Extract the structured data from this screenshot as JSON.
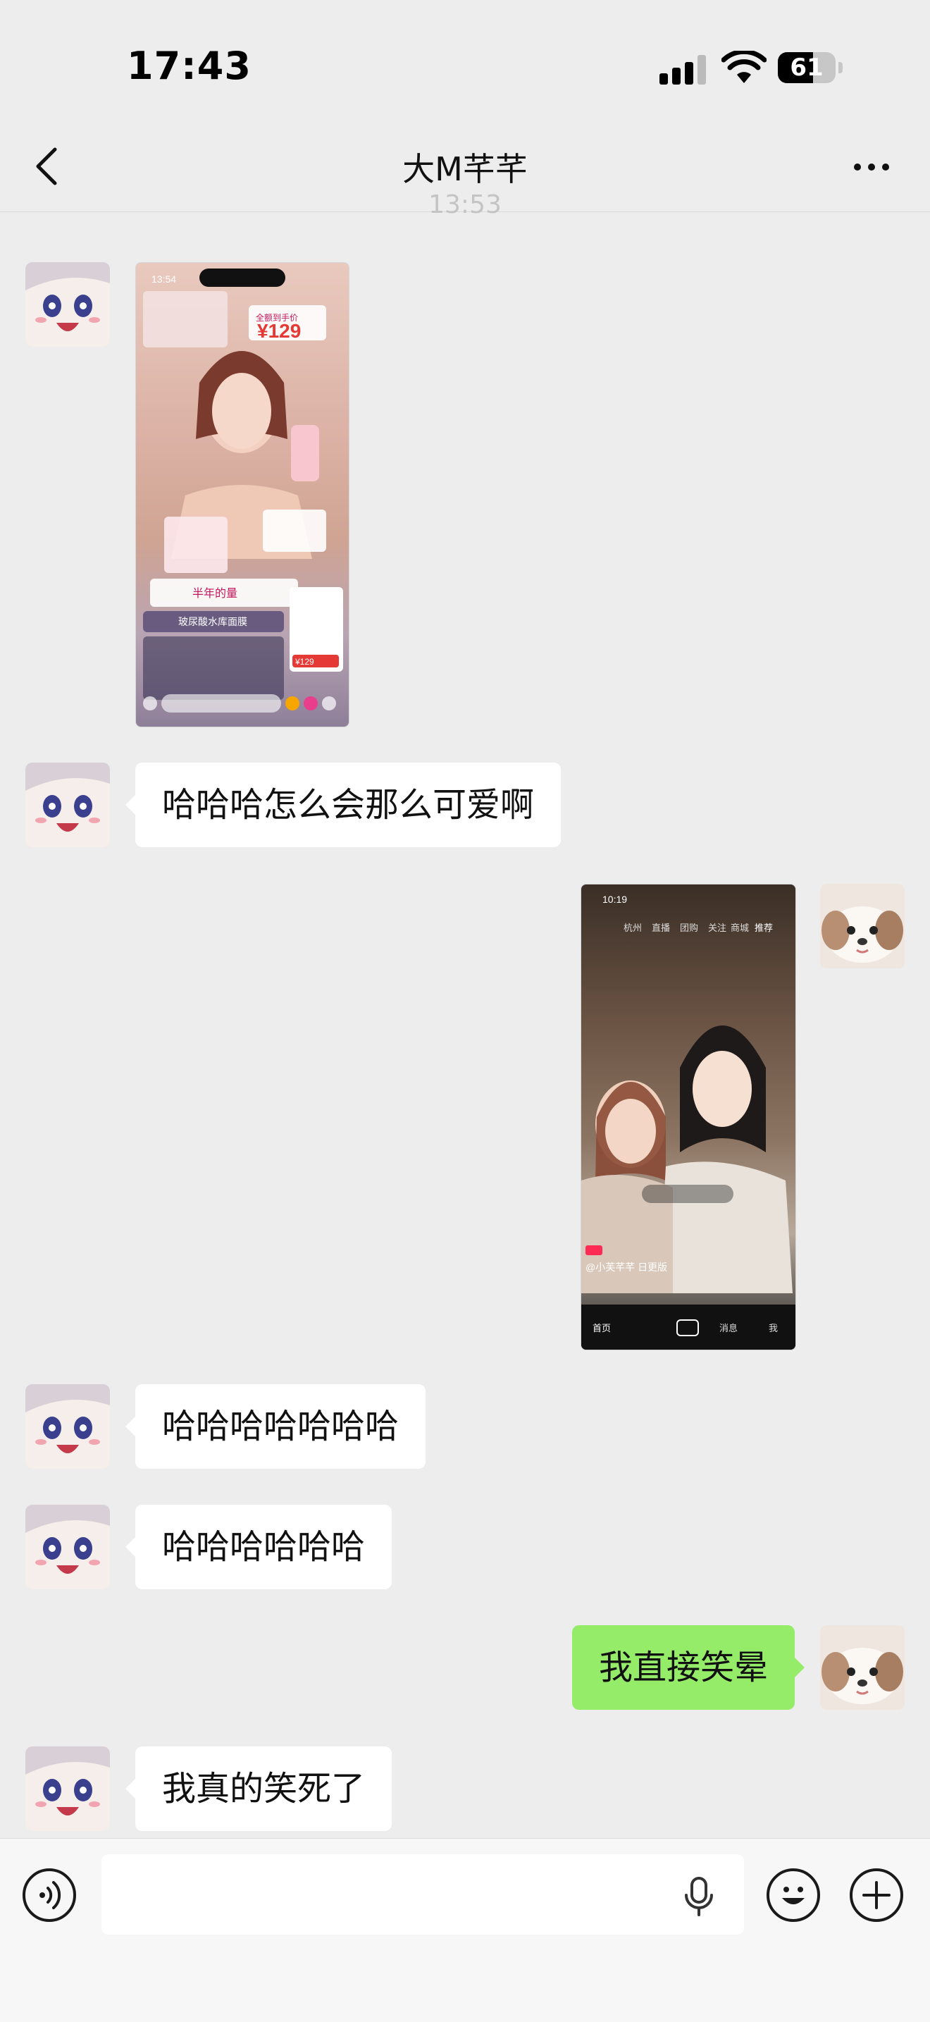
{
  "status_bar": {
    "time": "17:43",
    "battery": "61",
    "battery_level": 0.61
  },
  "nav": {
    "title": "大M芊芊",
    "back_icon": "chevron-left-icon",
    "more_icon": "ellipsis-icon"
  },
  "timestamp": "13:53",
  "messages": [
    {
      "side": "left",
      "type": "image",
      "thumbnail_texts": [
        "13:54",
        "全额到手价",
        "¥129",
        "半年的量",
        "玻尿酸水库面膜",
        "¥129"
      ]
    },
    {
      "side": "left",
      "type": "text",
      "text": "哈哈哈怎么会那么可爱啊"
    },
    {
      "side": "right",
      "type": "image",
      "thumbnail_texts": [
        "10:19",
        "杭州",
        "直播",
        "团购",
        "关注",
        "商城",
        "推荐",
        "@小芙芊芊 日更版",
        "首页",
        "消息",
        "我"
      ]
    },
    {
      "side": "left",
      "type": "text",
      "text": "哈哈哈哈哈哈哈"
    },
    {
      "side": "left",
      "type": "text",
      "text": "哈哈哈哈哈哈"
    },
    {
      "side": "right",
      "type": "text",
      "text": "我直接笑晕"
    },
    {
      "side": "left",
      "type": "text",
      "text": "我真的笑死了"
    }
  ],
  "input_bar": {
    "voice_icon": "voice-icon",
    "mic_icon": "microphone-icon",
    "emoji_icon": "smiley-icon",
    "plus_icon": "plus-icon"
  },
  "colors": {
    "background": "#ededed",
    "bubble_right": "#95ec69",
    "bubble_left": "#ffffff"
  }
}
